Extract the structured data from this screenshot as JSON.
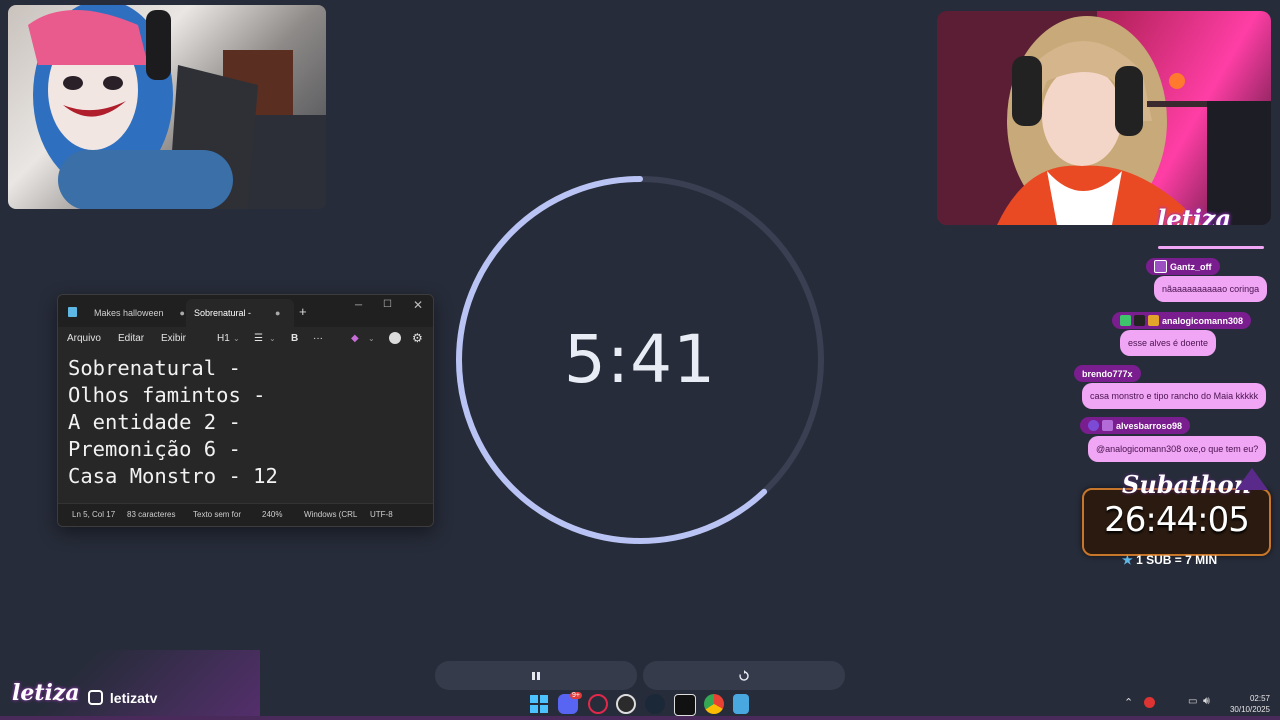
{
  "colors": {
    "background": "#272c3a",
    "timer_ring": "#b9c4f5",
    "timer_track": "#3a4052",
    "chat_name_bg": "#7a1d8e",
    "chat_bubble_bg": "#f0a6f4"
  },
  "webcams": {
    "right_overlay_logo": "letiza"
  },
  "timer": {
    "display": "5:41",
    "progress_fraction": 0.62
  },
  "controls": {
    "pause_icon": "pause-icon",
    "reset_icon": "reset-icon"
  },
  "notepad": {
    "tabs": [
      {
        "label": "Makes halloween"
      },
      {
        "label": "Sobrenatural -"
      }
    ],
    "new_tab": "+",
    "menu": {
      "file": "Arquivo",
      "edit": "Editar",
      "view": "Exibir",
      "heading": "H1",
      "bold": "B",
      "more": "···"
    },
    "content_lines": [
      "Sobrenatural -",
      "Olhos famintos -",
      "A entidade 2 -",
      "Premonição 6 -",
      "Casa Monstro - 12"
    ],
    "status": {
      "position": "Ln 5, Col 17",
      "chars": "83 caracteres",
      "format": "Texto sem for",
      "zoom": "240%",
      "line_ending": "Windows (CRL",
      "encoding": "UTF-8"
    }
  },
  "chat": [
    {
      "user": "Gantz_off",
      "text": "nãaaaaaaaaaao coringa"
    },
    {
      "user": "analogicomann308",
      "text": "esse alves é doente"
    },
    {
      "user": "brendo777x",
      "text": "casa monstro e tipo rancho do Maia kkkkk"
    },
    {
      "user": "alvesbarroso98",
      "text": "@analogicomann308 oxe,o que tem eu?"
    }
  ],
  "subathon": {
    "title": "Subathon",
    "time": "26:44:05",
    "rule": "1 SUB = 7 MIN"
  },
  "branding": {
    "logo": "letiza",
    "handle": "letizatv"
  },
  "taskbar": {
    "discord_badge": "9+",
    "time": "02:57",
    "date": "30/10/2025"
  }
}
